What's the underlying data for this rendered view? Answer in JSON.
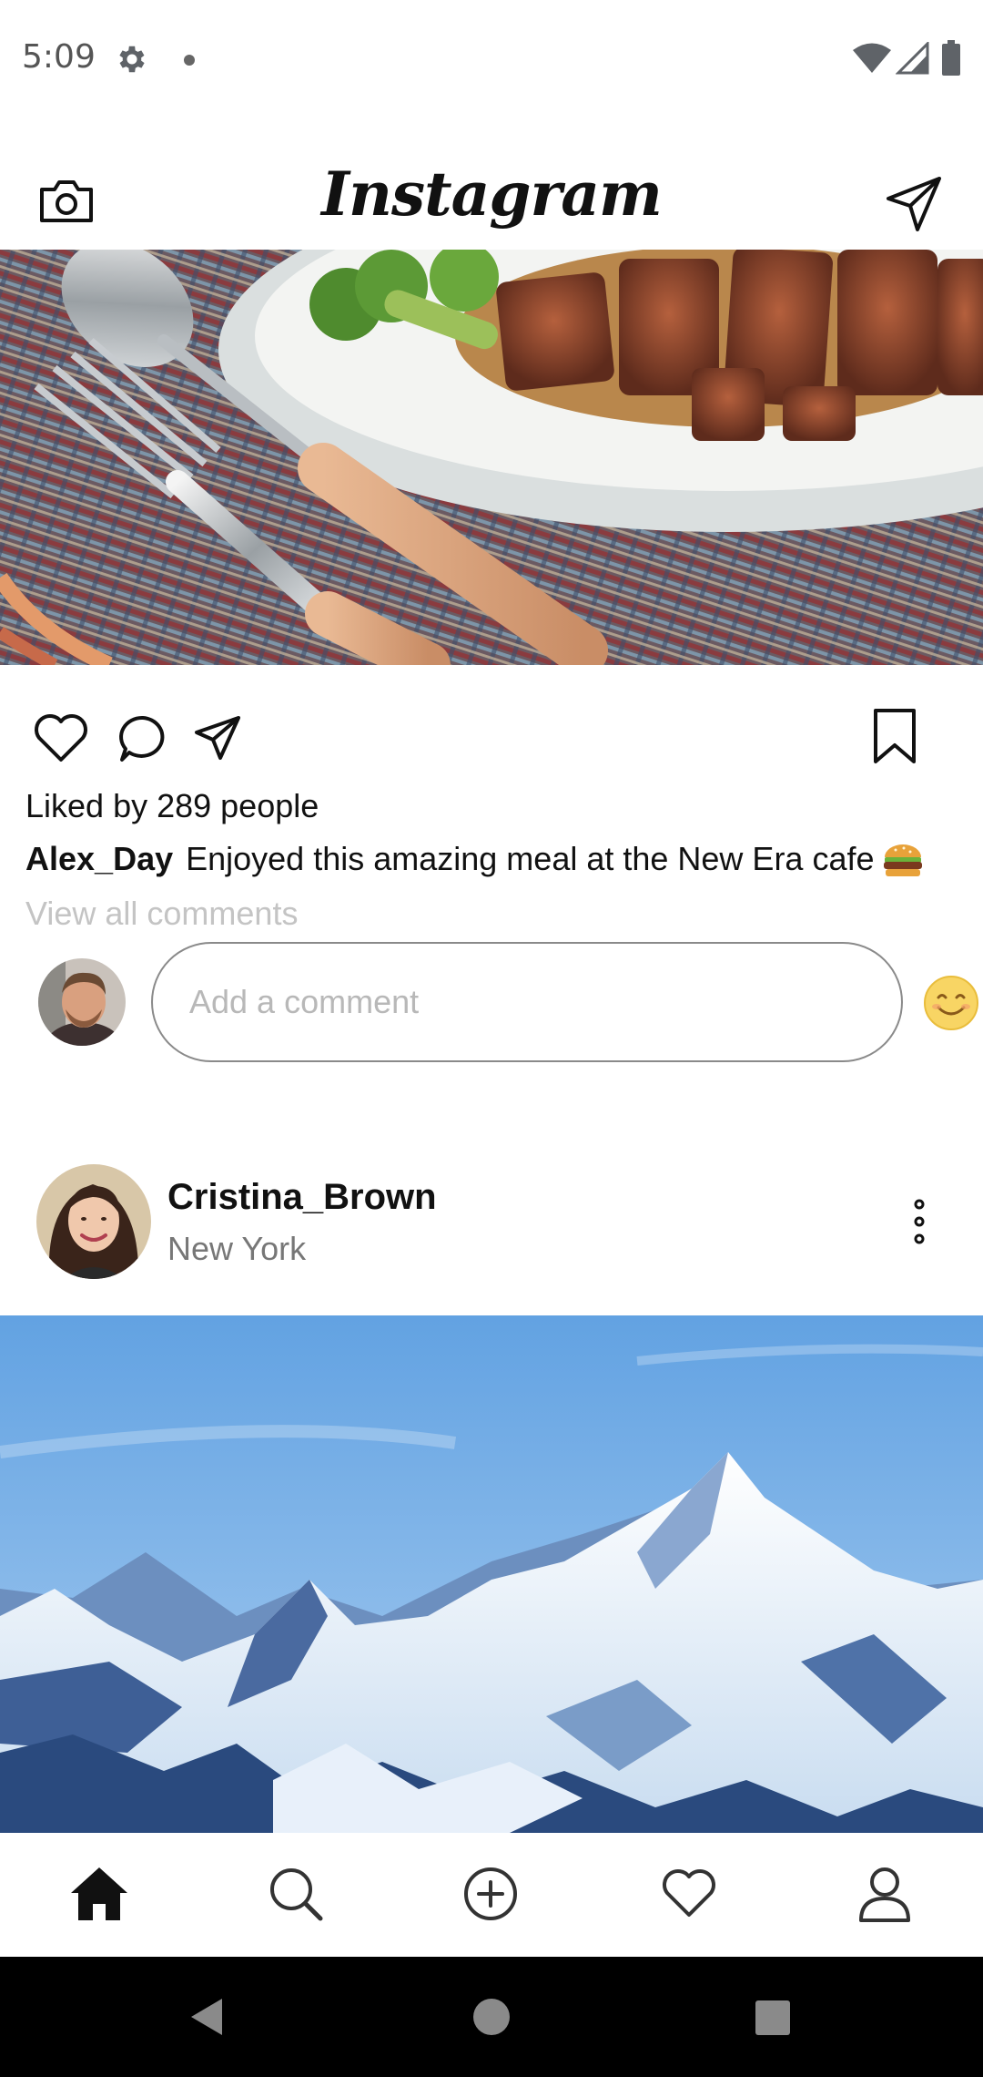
{
  "status_bar": {
    "time": "5:09",
    "icons": [
      "gear-icon",
      "notification-dot-icon",
      "wifi-icon",
      "cell-signal-icon",
      "battery-icon"
    ]
  },
  "header": {
    "logo_text": "Instagram",
    "left_icon": "camera-icon",
    "right_icon": "direct-message-icon"
  },
  "post1": {
    "image_icon": "food-photo",
    "actions": [
      "heart-icon",
      "comment-icon",
      "share-icon",
      "bookmark-icon"
    ],
    "likes_text": "Liked by 289 people",
    "caption_user": "Alex_Day",
    "caption_text": "Enjoyed this amazing meal at the New Era cafe",
    "caption_emoji": "burger-emoji",
    "view_comments": "View all comments",
    "comment_placeholder": "Add a comment",
    "comment_emoji": "smiley-emoji"
  },
  "post2": {
    "username": "Cristina_Brown",
    "location": "New York",
    "more_icon": "more-vertical-icon",
    "image_icon": "mountain-photo"
  },
  "bottom_nav": [
    "home-icon",
    "search-icon",
    "add-post-icon",
    "activity-heart-icon",
    "profile-icon"
  ],
  "system_nav": [
    "back-icon",
    "home-circle-icon",
    "recents-icon"
  ],
  "colors": {
    "text": "#111111",
    "muted": "#777777",
    "placeholder": "#b8b8b8",
    "system_nav_bg": "#000000"
  }
}
